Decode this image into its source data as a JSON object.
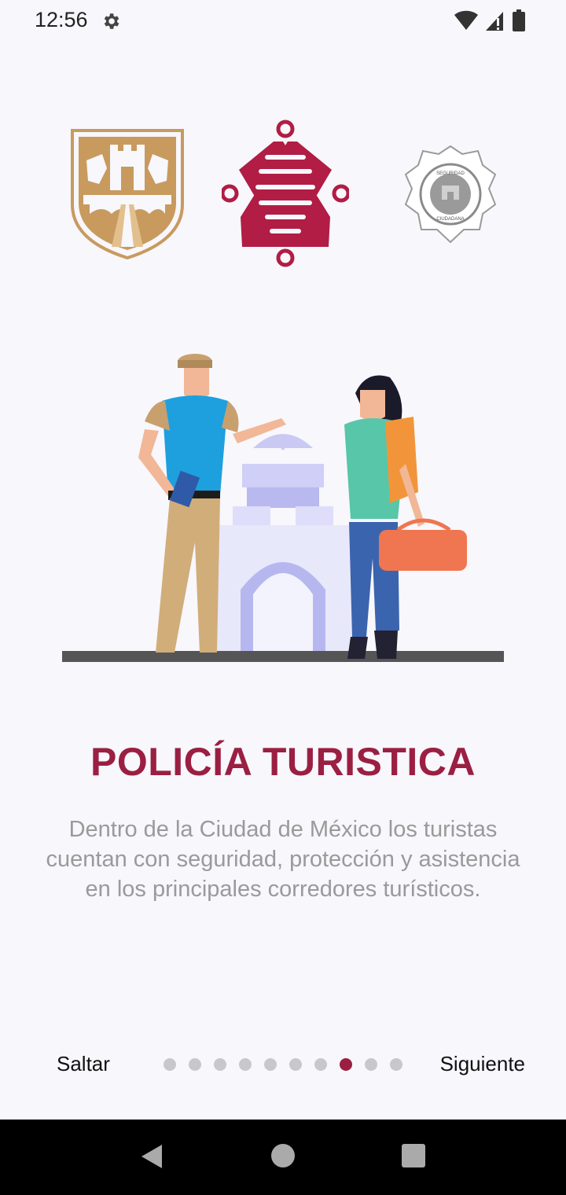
{
  "status_bar": {
    "time": "12:56",
    "icons": [
      "settings-icon",
      "wifi-icon",
      "signal-icon",
      "battery-icon"
    ]
  },
  "logos": [
    "cdmx-shield-logo",
    "ssc-knot-logo",
    "seguridad-ciudadana-badge-logo"
  ],
  "badge_text": {
    "top": "SEGURIDAD",
    "bottom": "CIUDADANA"
  },
  "illustration": "tourist-police-illustration",
  "title": "POLICÍA TURISTICA",
  "description": "Dentro de la Ciudad de México los turistas cuentan con seguridad, protección y asistencia en los principales corredores turísticos.",
  "navigation": {
    "skip_label": "Saltar",
    "next_label": "Siguiente",
    "total_pages": 10,
    "current_page": 8
  },
  "colors": {
    "accent": "#9b1f42",
    "gold": "#c89a5e",
    "background": "#f7f7fc",
    "dot_inactive": "#c8c8cc",
    "text_muted": "#9a9a9a"
  },
  "system_nav": [
    "back-icon",
    "home-icon",
    "recents-icon"
  ]
}
